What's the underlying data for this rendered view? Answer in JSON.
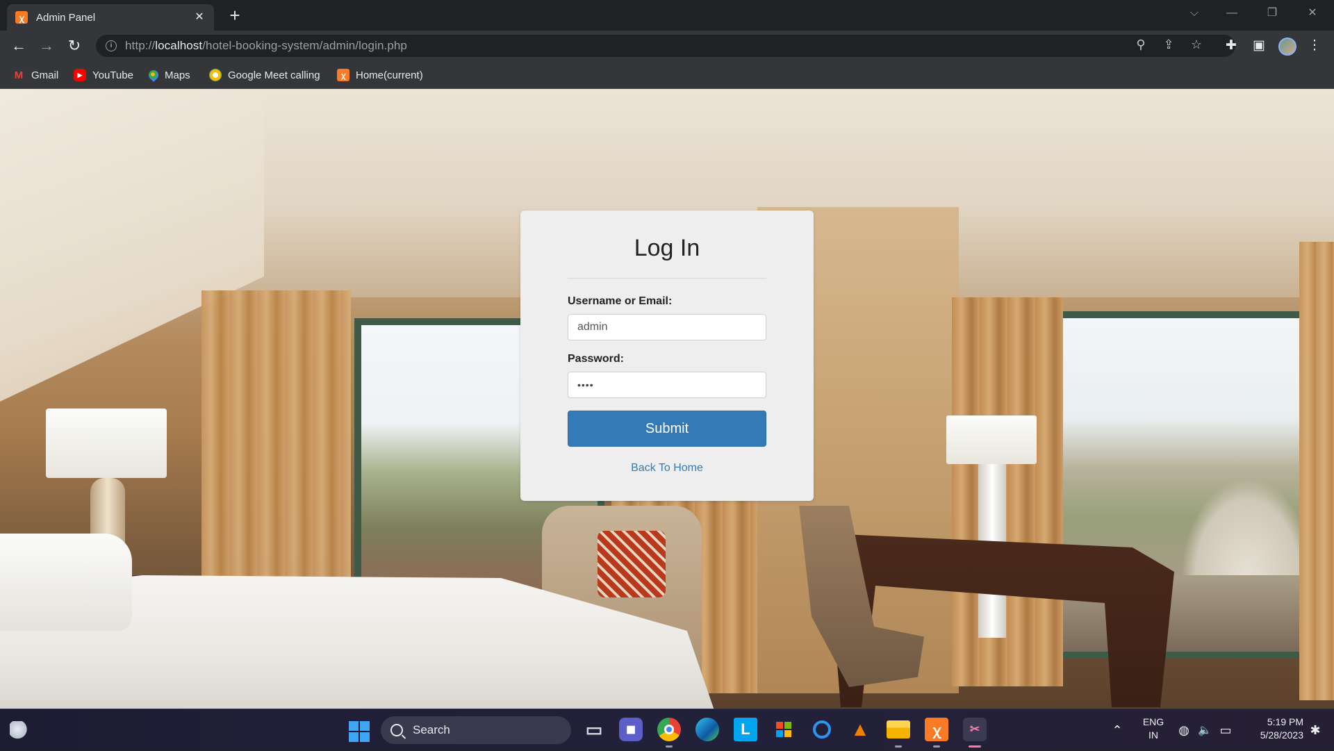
{
  "browser": {
    "tab": {
      "title": "Admin Panel",
      "favicon": "xampp-icon",
      "close_glyph": "✕"
    },
    "new_tab_glyph": "+",
    "window_controls": {
      "dropdown": "⌵",
      "minimize": "—",
      "restore": "❐",
      "close": "✕"
    },
    "nav": {
      "back": "←",
      "forward": "→",
      "reload": "↻"
    },
    "address": {
      "scheme": "http://",
      "host": "localhost",
      "path": "/hotel-booking-system/admin/login.php"
    },
    "toolbar_icons": {
      "zoom": "⚲",
      "share": "⇪",
      "bookmark": "☆",
      "extensions": "✚",
      "side_panel": "▣",
      "menu": "⋮"
    },
    "bookmarks": [
      {
        "label": "Gmail",
        "icon": "gmail-icon",
        "glyph": "M",
        "color": "#ea4335"
      },
      {
        "label": "YouTube",
        "icon": "youtube-icon",
        "glyph": "▶",
        "color": "#ff0000"
      },
      {
        "label": "Maps",
        "icon": "maps-icon",
        "glyph": "◉",
        "color": "#34a853"
      },
      {
        "label": "Google Meet calling",
        "icon": "meet-icon",
        "glyph": "●",
        "color": "#fbbc04"
      },
      {
        "label": "Home(current)",
        "icon": "xampp-icon",
        "glyph": "ꭓ",
        "color": "#fb7a24"
      }
    ]
  },
  "login": {
    "title": "Log In",
    "username_label": "Username or Email:",
    "username_value": "admin",
    "password_label": "Password:",
    "password_value": "••••",
    "submit_label": "Submit",
    "back_link": "Back To Home"
  },
  "taskbar": {
    "search_label": "Search",
    "apps": [
      {
        "name": "task-view-icon",
        "glyph": "▭",
        "bg": "#3b3b52"
      },
      {
        "name": "teams-icon",
        "glyph": "◼",
        "bg": "#5b5fc7"
      },
      {
        "name": "chrome-icon",
        "glyph": "◎",
        "bg": "#d93025"
      },
      {
        "name": "edge-icon",
        "glyph": "◔",
        "bg": "#0f8fd6"
      },
      {
        "name": "l-app-icon",
        "glyph": "L",
        "bg": "#00a4ef"
      },
      {
        "name": "store-icon",
        "glyph": "▦",
        "bg": "#2a2a3e"
      },
      {
        "name": "cortana-icon",
        "glyph": "○",
        "bg": "#0b6bd3"
      },
      {
        "name": "vlc-icon",
        "glyph": "▲",
        "bg": "#e86f00"
      },
      {
        "name": "file-explorer-icon",
        "glyph": "▬",
        "bg": "#f4c430"
      },
      {
        "name": "xampp-icon",
        "glyph": "ꭓ",
        "bg": "#fb7a24"
      },
      {
        "name": "snipping-tool-icon",
        "glyph": "✂",
        "bg": "#3a3a50"
      }
    ],
    "tray": {
      "overflow": "⌃",
      "lang_top": "ENG",
      "lang_bottom": "IN",
      "net": "◍",
      "volume": "🔈",
      "battery": "▭",
      "time": "5:19 PM",
      "date": "5/28/2023",
      "notification": "✱"
    }
  }
}
